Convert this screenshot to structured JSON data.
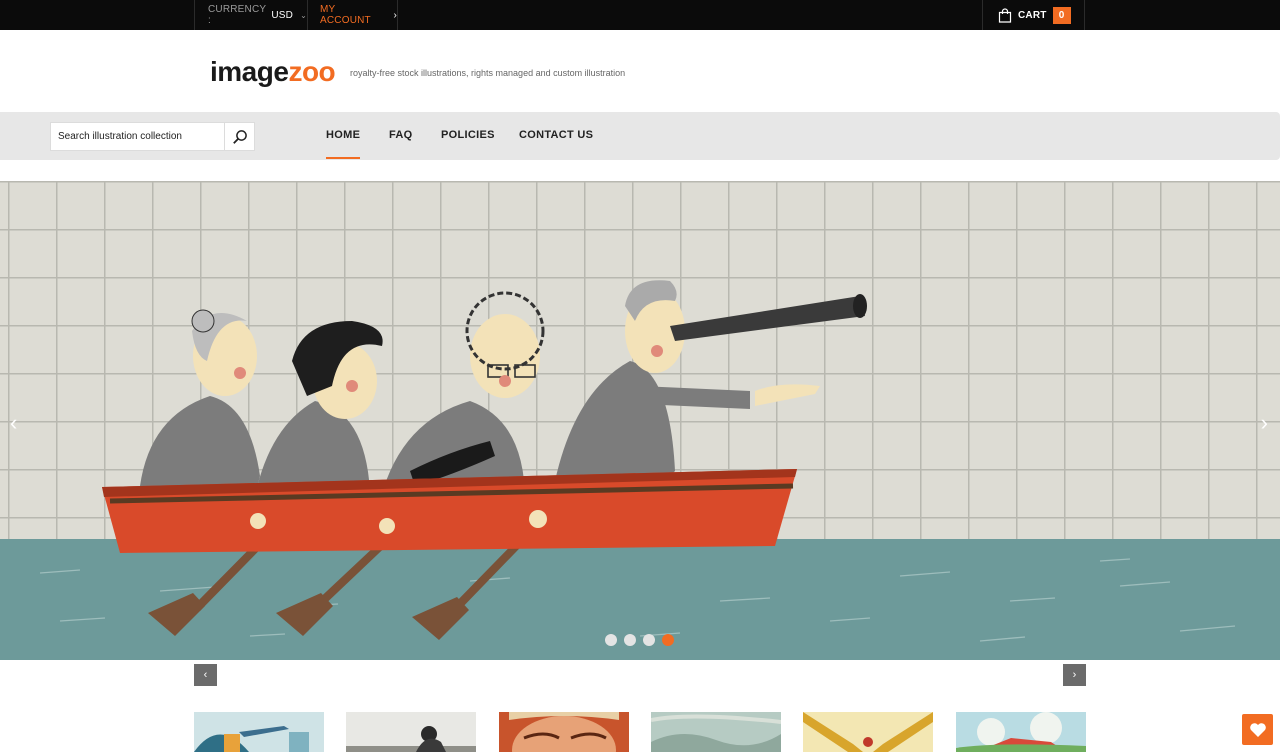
{
  "topbar": {
    "currency_label": "CURRENCY :",
    "currency_value": "USD",
    "account_label": "MY ACCOUNT",
    "cart_label": "CART",
    "cart_count": "0"
  },
  "header": {
    "logo_part1": "image",
    "logo_part2": "zoo",
    "tagline": "royalty-free stock illustrations, rights managed and custom illustration"
  },
  "search": {
    "placeholder": "Search illustration collection"
  },
  "nav": {
    "items": [
      {
        "label": "HOME",
        "active": true
      },
      {
        "label": "FAQ"
      },
      {
        "label": "POLICIES"
      },
      {
        "label": "CONTACT US"
      }
    ]
  },
  "hero": {
    "slide_count": 4,
    "active_slide": 4,
    "prev_icon": "chevron-left-icon",
    "next_icon": "chevron-right-icon"
  },
  "carousel": {
    "thumbnails": 6,
    "prev_icon": "chevron-left-icon",
    "next_icon": "chevron-right-icon"
  },
  "colors": {
    "accent": "#f26c22",
    "topbar": "#0b0b0b",
    "navbar": "#e7e7e7",
    "water": "#6d9a9a",
    "boat": "#d94a2a"
  }
}
